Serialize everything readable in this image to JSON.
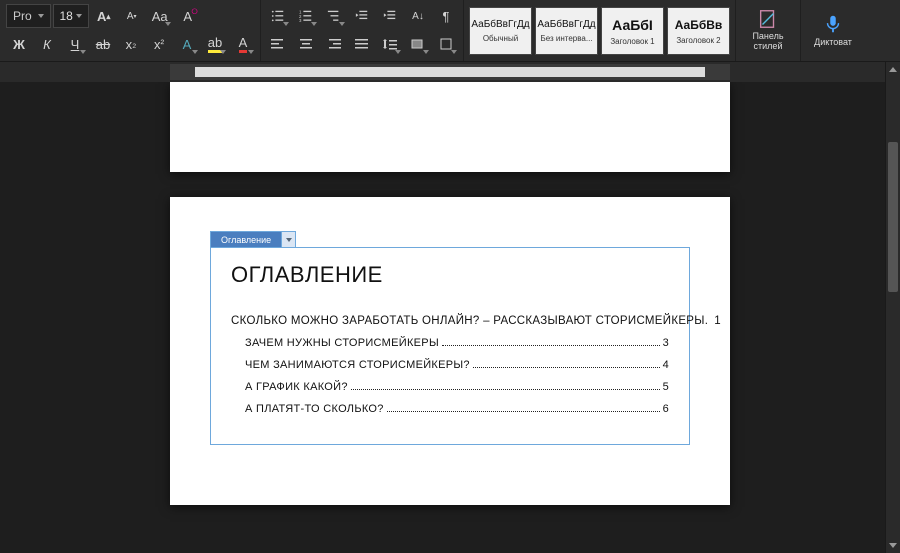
{
  "ribbon": {
    "font_name": "Pro",
    "font_size": "18",
    "styles": [
      {
        "preview": "АаБбВвГгДд",
        "name": "Обычный"
      },
      {
        "preview": "АаБбВвГгДд",
        "name": "Без интерва..."
      },
      {
        "preview": "АаБбІ",
        "name": "Заголовок 1"
      },
      {
        "preview": "АаБбВв",
        "name": "Заголовок 2"
      }
    ],
    "styles_pane": "Панель стилей",
    "dictate": "Диктоват"
  },
  "toc": {
    "tab_label": "Оглавление",
    "title": "ОГЛАВЛЕНИЕ",
    "items": [
      {
        "level": 1,
        "label": "СКОЛЬКО МОЖНО ЗАРАБОТАТЬ ОНЛАЙН? – РАССКАЗЫВАЮТ СТОРИСМЕЙКЕРЫ.",
        "page": "1",
        "leader": false
      },
      {
        "level": 2,
        "label": "ЗАЧЕМ НУЖНЫ СТОРИСМЕЙКЕРЫ",
        "page": "3",
        "leader": true
      },
      {
        "level": 2,
        "label": "ЧЕМ ЗАНИМАЮТСЯ СТОРИСМЕЙКЕРЫ?",
        "page": "4",
        "leader": true
      },
      {
        "level": 2,
        "label": "А ГРАФИК КАКОЙ?",
        "page": "5",
        "leader": true
      },
      {
        "level": 2,
        "label": "А ПЛАТЯТ-ТО СКОЛЬКО?",
        "page": "6",
        "leader": true
      }
    ]
  }
}
